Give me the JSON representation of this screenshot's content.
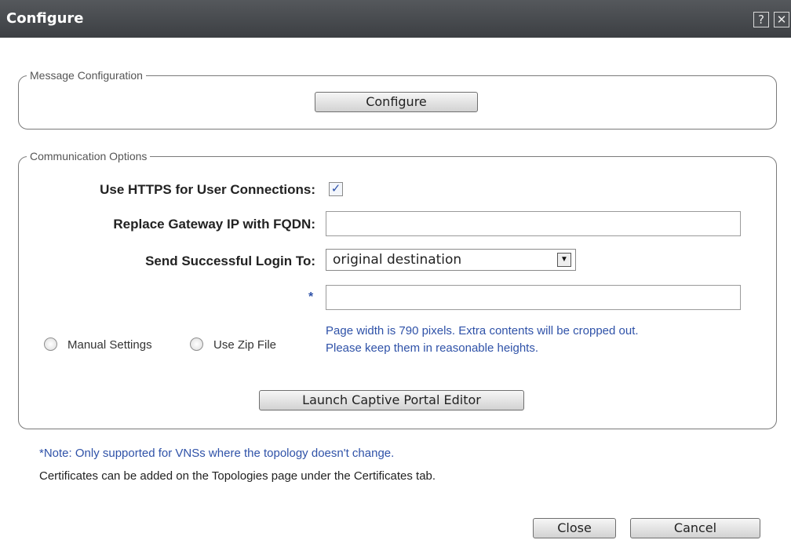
{
  "window": {
    "title": "Configure",
    "help_label": "?",
    "close_label": "✕"
  },
  "message_config": {
    "legend": "Message Configuration",
    "configure_button": "Configure"
  },
  "communication": {
    "legend": "Communication Options",
    "https_label": "Use HTTPS for User Connections:",
    "https_checked": true,
    "https_check_glyph": "✓",
    "fqdn_label": "Replace Gateway IP with FQDN:",
    "fqdn_value": "",
    "login_label": "Send Successful Login To:",
    "login_selected": "original destination",
    "dropdown_arrow": "▼",
    "required_marker": "*",
    "url_value": "",
    "radio_manual_label": "Manual Settings",
    "radio_zip_label": "Use Zip File",
    "info_line1": "Page width is 790 pixels. Extra contents will be cropped out.",
    "info_line2": "Please keep them in reasonable heights.",
    "launch_button": "Launch Captive Portal Editor"
  },
  "notes": {
    "note1": "*Note: Only supported for VNSs where the topology doesn't change.",
    "note2": "Certificates can be added on the Topologies page under the Certificates tab.",
    "note1_color": "#2f52a8",
    "note2_color": "#222222"
  },
  "footer": {
    "close_button": "Close",
    "cancel_button": "Cancel"
  }
}
